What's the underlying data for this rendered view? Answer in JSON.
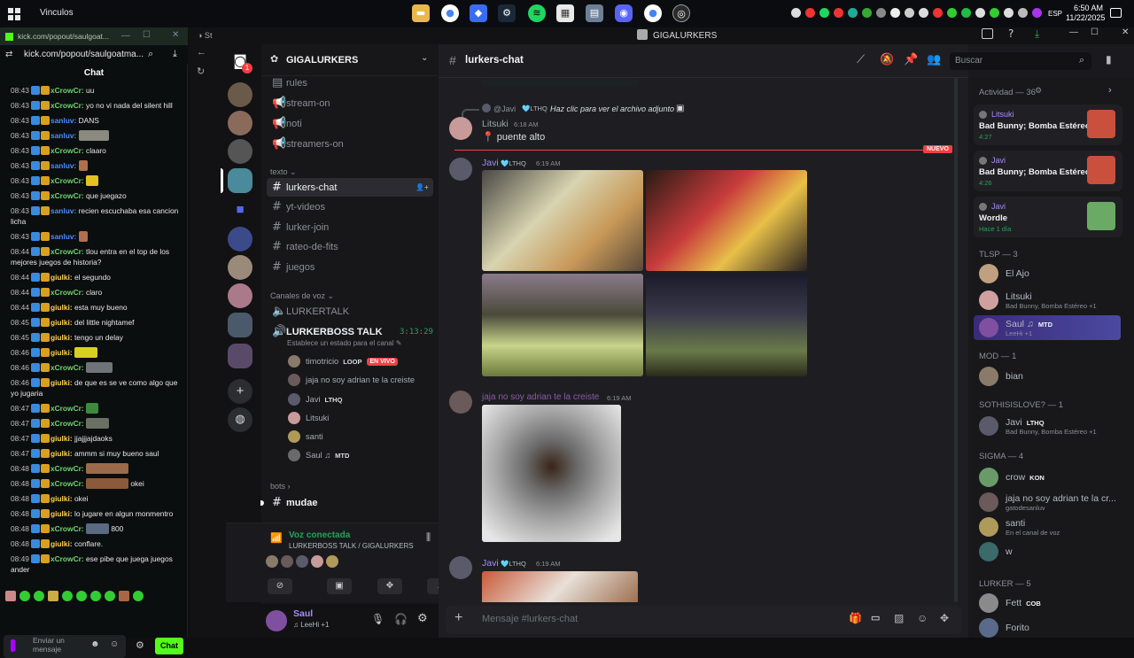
{
  "taskbar": {
    "title": "Vinculos",
    "lang": "ESP",
    "time": "6:50 AM",
    "date": "11/22/2025"
  },
  "kick": {
    "url_tab": "kick.com/popout/saulgoat...",
    "url": "kick.com/popout/saulgoatma...",
    "chat_title": "Chat",
    "input_placeholder": "Enviar un mensaje",
    "send_label": "Chat",
    "messages": [
      {
        "time": "08:43",
        "user": "xCrowCr:",
        "color": "#6fd46f",
        "text": "uu"
      },
      {
        "time": "08:43",
        "user": "xCrowCr:",
        "color": "#6fd46f",
        "text": "yo no vi nada del silent hill"
      },
      {
        "time": "08:43",
        "user": "sanluv:",
        "color": "#4d8cff",
        "text": "DANS"
      },
      {
        "time": "08:43",
        "user": "sanluv:",
        "color": "#4d8cff",
        "text": "",
        "emote": "#8a8a80",
        "ew": 34
      },
      {
        "time": "08:43",
        "user": "xCrowCr:",
        "color": "#6fd46f",
        "text": "claaro"
      },
      {
        "time": "08:43",
        "user": "sanluv:",
        "color": "#4d8cff",
        "text": "",
        "emote": "#b07050",
        "ew": 10
      },
      {
        "time": "08:43",
        "user": "xCrowCr:",
        "color": "#6fd46f",
        "text": "",
        "emote": "#e4c220",
        "ew": 14
      },
      {
        "time": "08:43",
        "user": "xCrowCr:",
        "color": "#6fd46f",
        "text": "que juegazo"
      },
      {
        "time": "08:43",
        "user": "sanluv:",
        "color": "#4d8cff",
        "text": "recien escuchaba esa cancion licha"
      },
      {
        "time": "08:43",
        "user": "sanluv:",
        "color": "#4d8cff",
        "text": "",
        "emote": "#b07050",
        "ew": 10
      },
      {
        "time": "08:44",
        "user": "xCrowCr:",
        "color": "#6fd46f",
        "text": "tlou entra en el top de los mejores juegos de historia?"
      },
      {
        "time": "08:44",
        "user": "giulki:",
        "color": "#ffd24d",
        "text": "el segundo"
      },
      {
        "time": "08:44",
        "user": "xCrowCr:",
        "color": "#6fd46f",
        "text": "claro"
      },
      {
        "time": "08:44",
        "user": "giulki:",
        "color": "#ffd24d",
        "text": "esta muy bueno"
      },
      {
        "time": "08:45",
        "user": "giulki:",
        "color": "#ffd24d",
        "text": "del little nightamef"
      },
      {
        "time": "08:45",
        "user": "giulki:",
        "color": "#ffd24d",
        "text": "tengo un delay"
      },
      {
        "time": "08:46",
        "user": "giulki:",
        "color": "#ffd24d",
        "text": "",
        "emote": "#d8d020",
        "ew": 26
      },
      {
        "time": "08:46",
        "user": "xCrowCr:",
        "color": "#6fd46f",
        "text": "",
        "emote": "#707478",
        "ew": 30
      },
      {
        "time": "08:46",
        "user": "giulki:",
        "color": "#ffd24d",
        "text": "de que es se ve como algo que yo jugaria"
      },
      {
        "time": "08:47",
        "user": "xCrowCr:",
        "color": "#6fd46f",
        "text": "",
        "emote": "#3c8a3c",
        "ew": 14
      },
      {
        "time": "08:47",
        "user": "xCrowCr:",
        "color": "#6fd46f",
        "text": "",
        "emote": "#6a7064",
        "ew": 26
      },
      {
        "time": "08:47",
        "user": "giulki:",
        "color": "#ffd24d",
        "text": "jjajjjajdaoks"
      },
      {
        "time": "08:47",
        "user": "giulki:",
        "color": "#ffd24d",
        "text": "ammm si muy bueno saul"
      },
      {
        "time": "08:48",
        "user": "xCrowCr:",
        "color": "#6fd46f",
        "text": "",
        "emote": "#9a6a4a",
        "ew": 48
      },
      {
        "time": "08:48",
        "user": "xCrowCr:",
        "color": "#6fd46f",
        "text": "okei",
        "emote": "#8a5a3a",
        "ew": 48
      },
      {
        "time": "08:48",
        "user": "giulki:",
        "color": "#ffd24d",
        "text": "okei"
      },
      {
        "time": "08:48",
        "user": "giulki:",
        "color": "#ffd24d",
        "text": "lo jugare en algun monmentro"
      },
      {
        "time": "08:48",
        "user": "xCrowCr:",
        "color": "#6fd46f",
        "text": "800",
        "emote": "#5a6a80",
        "ew": 26
      },
      {
        "time": "08:48",
        "user": "giulki:",
        "color": "#ffd24d",
        "text": "conflare."
      },
      {
        "time": "08:49",
        "user": "xCrowCr:",
        "color": "#6fd46f",
        "text": "ese pibe que juega juegos ander"
      }
    ]
  },
  "discord": {
    "window_title": "GIGALURKERS",
    "server_name": "GIGALURKERS",
    "guild_badge": "1",
    "channels_top": [
      "rules",
      "stream-on",
      "noti",
      "streamers-on"
    ],
    "cat_texto": "texto",
    "text_channels": [
      "lurkers-chat",
      "yt-videos",
      "lurker-join",
      "rateo-de-fits",
      "juegos"
    ],
    "cat_voice": "Canales de voz",
    "voice_channels": [
      "LURKERTALK",
      "LURKERBOSS TALK"
    ],
    "voice_timer": "3:13:29",
    "voice_status": "Establece un estado para el canal",
    "voice_users": [
      {
        "name": "timotricio",
        "tag": "LOOP",
        "live": "EN VIVO",
        "color": "#8a7a6a"
      },
      {
        "name": "jaja no soy adrian te la creiste",
        "color": "#6a5a5a"
      },
      {
        "name": "Javi",
        "tag": "LTHQ",
        "color": "#5a5a6a"
      },
      {
        "name": "Litsuki",
        "color": "#c89a9a"
      },
      {
        "name": "santi",
        "color": "#b09a5a"
      },
      {
        "name": "Saul ♫",
        "tag": "MTD",
        "color": "#6a6a6a"
      }
    ],
    "cat_bots": "bots",
    "bot_channel": "mudae",
    "voice_connected": "Voz conectada",
    "voice_path": "LURKERBOSS TALK / GIGALURKERS",
    "user_name": "Saul",
    "user_status": "LeeHi +1",
    "channel_title": "lurkers-chat",
    "search_placeholder": "Buscar",
    "messages": {
      "reply_user": "@Javi",
      "reply_tag": "LTHQ",
      "reply_text": "Haz clic para ver el archivo adjunto",
      "m1_user": "Litsuki",
      "m1_time": "6:18 AM",
      "m1_text": "📍 puente alto",
      "new_label": "NUEVO",
      "m2_user": "Javi",
      "m2_tag": "LTHQ",
      "m2_time": "6:19 AM",
      "m3_user": "jaja no soy adrian te la creiste",
      "m3_time": "6:19 AM",
      "m4_user": "Javi",
      "m4_tag": "LTHQ",
      "m4_time": "6:19 AM"
    },
    "composer_placeholder": "Mensaje #lurkers-chat",
    "members": {
      "activity_head": "Actividad — 36",
      "activities": [
        {
          "user": "Litsuki",
          "title": "Bad Bunny; Bomba Estéreo",
          "sub": "4:27",
          "color": "#c8503c"
        },
        {
          "user": "Javi",
          "title": "Bad Bunny; Bomba Estéreo",
          "sub": "4:26",
          "color": "#c8503c"
        },
        {
          "user": "Javi",
          "title": "Wordle",
          "sub": "Hace 1 día",
          "color": "#6aaa64"
        }
      ],
      "tlsp_head": "TLSP — 3",
      "tlsp": [
        {
          "name": "El Ajo",
          "sub": "",
          "color": "#c0a080"
        },
        {
          "name": "Litsuki",
          "sub": "Bad Bunny, Bomba Estéreo +1",
          "color": "#d0a0a0"
        },
        {
          "name": "Saul ♫",
          "tag": "MTD",
          "sub": "LeeHi +1",
          "color": "#8050a0"
        }
      ],
      "mod_head": "MOD — 1",
      "mod": [
        {
          "name": "bian",
          "color": "#8a7a6a"
        }
      ],
      "sothis_head": "SOTHISISLOVE? — 1",
      "sothis": [
        {
          "name": "Javi",
          "tag": "LTHQ",
          "sub": "Bad Bunny, Bomba Estéreo +1",
          "color": "#5a5a6a"
        }
      ],
      "sigma_head": "SIGMA — 4",
      "sigma": [
        {
          "name": "crow",
          "tag": "KON",
          "sub": "",
          "color": "#6a9a6a"
        },
        {
          "name": "jaja no soy adrian te la cr...",
          "sub": "gatodesanluv",
          "color": "#6a5a5a"
        },
        {
          "name": "santi",
          "sub": "En el canal de voz",
          "color": "#b09a5a"
        },
        {
          "name": "w",
          "sub": "",
          "color": "#3a6a6a"
        }
      ],
      "lurker_head": "LURKER — 5",
      "lurker": [
        {
          "name": "Fett",
          "tag": "COB",
          "color": "#8a8a8a"
        },
        {
          "name": "Forito",
          "color": "#5a6a8a"
        }
      ]
    },
    "colors": {
      "accent": "#5865f2",
      "live": "#ed4245",
      "new": "#f23f43",
      "kick_green": "#53fc18"
    }
  }
}
